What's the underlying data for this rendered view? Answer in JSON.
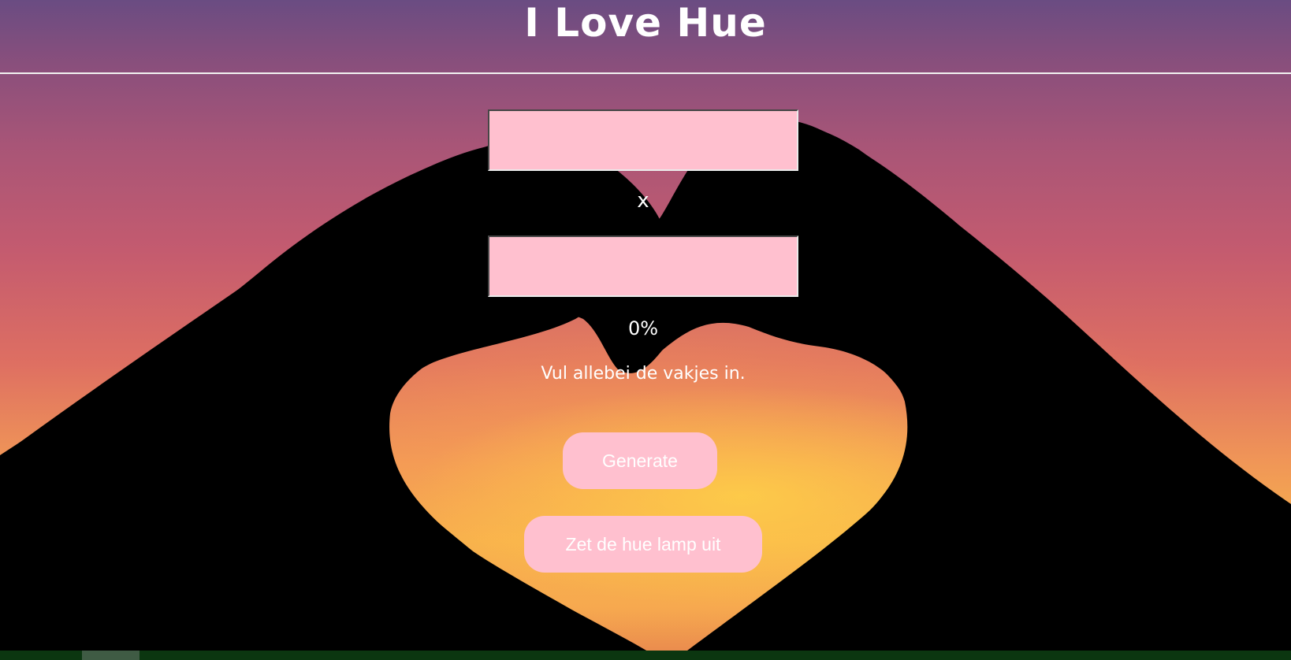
{
  "page": {
    "title": "I Love Hue"
  },
  "form": {
    "name1": {
      "value": "",
      "placeholder": ""
    },
    "separator": "x",
    "name2": {
      "value": "",
      "placeholder": ""
    },
    "percentage": "0%",
    "message": "Vul allebei de vakjes in."
  },
  "buttons": {
    "generate": "Generate",
    "lamp_off": "Zet de hue lamp uit"
  },
  "colors": {
    "accent_pink": "#ffc0cf",
    "text": "#ffffff",
    "bottom_bar": "#0b3610"
  }
}
